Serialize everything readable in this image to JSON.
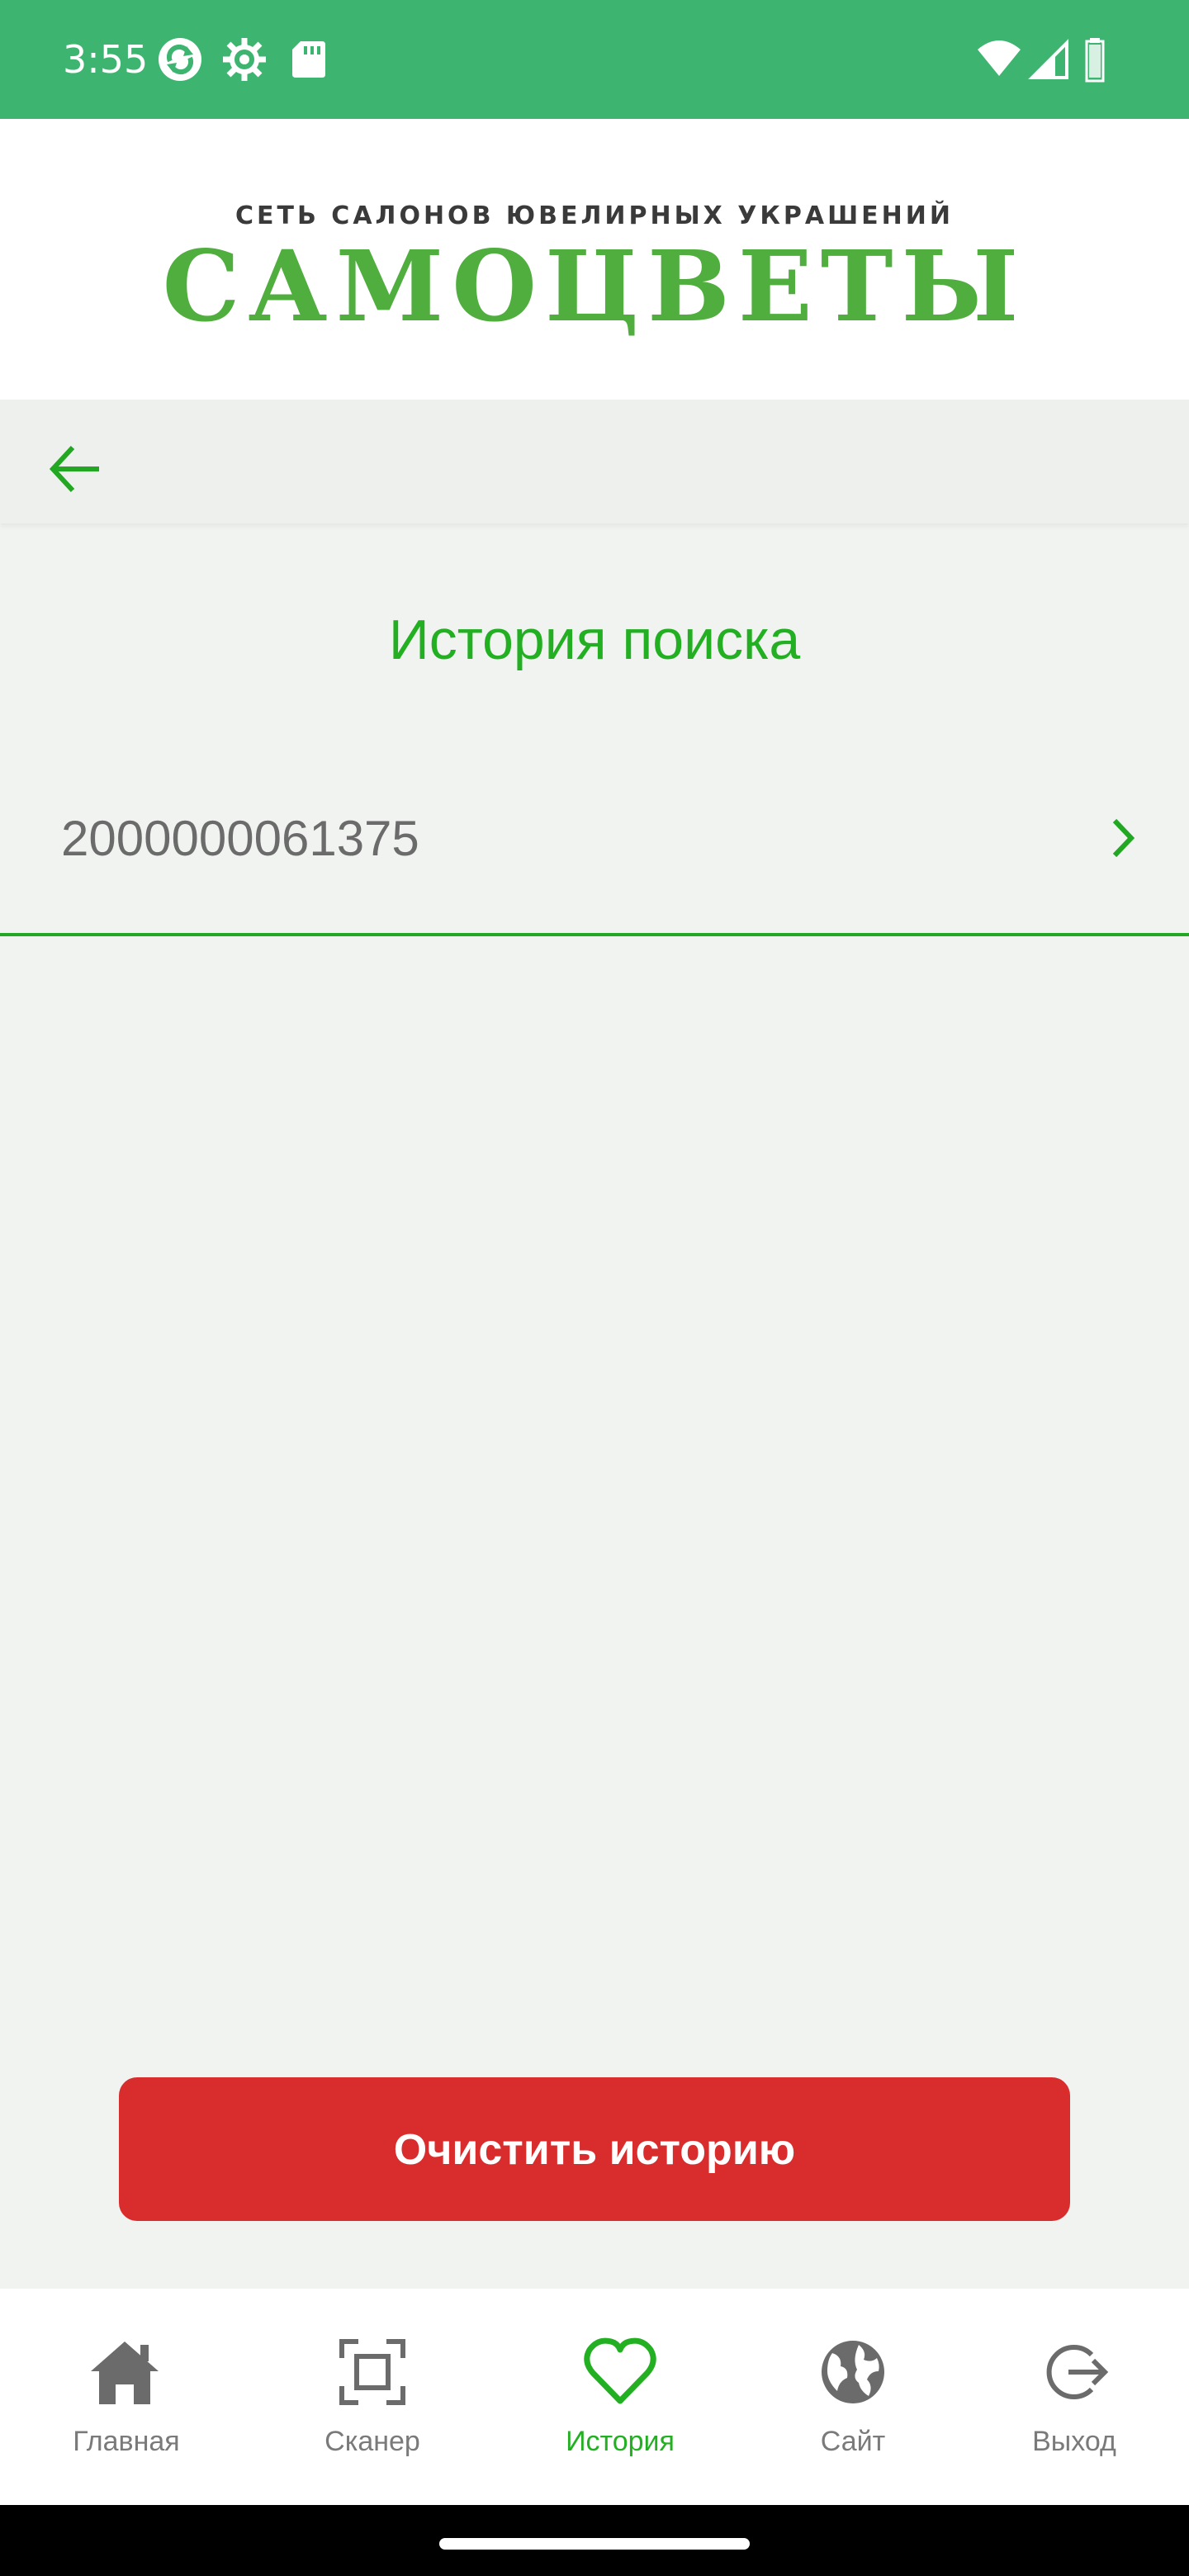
{
  "status_bar": {
    "time": "3:55",
    "icons": [
      "sync-icon",
      "settings-gear-icon",
      "sd-card-icon",
      "wifi-icon",
      "cell-signal-icon",
      "battery-icon"
    ]
  },
  "header": {
    "logo_subtitle": "СЕТЬ САЛОНОВ ЮВЕЛИРНЫХ УКРАШЕНИЙ",
    "logo_title": "САМОЦВЕТЫ"
  },
  "toolbar": {
    "back_icon": "arrow-left-icon"
  },
  "page": {
    "title": "История поиска",
    "history_items": [
      {
        "value": "2000000061375"
      }
    ]
  },
  "clear_button": {
    "label": "Очистить историю"
  },
  "bottom_nav": {
    "items": [
      {
        "label": "Главная",
        "icon": "home-icon",
        "active": false
      },
      {
        "label": "Сканер",
        "icon": "scanner-icon",
        "active": false
      },
      {
        "label": "История",
        "icon": "heart-icon",
        "active": true
      },
      {
        "label": "Сайт",
        "icon": "globe-icon",
        "active": false
      },
      {
        "label": "Выход",
        "icon": "logout-icon",
        "active": false
      }
    ]
  },
  "colors": {
    "status_bar": "#3eb471",
    "accent_green": "#22b022",
    "danger_red": "#d92d2d",
    "background": "#f1f3f1"
  }
}
